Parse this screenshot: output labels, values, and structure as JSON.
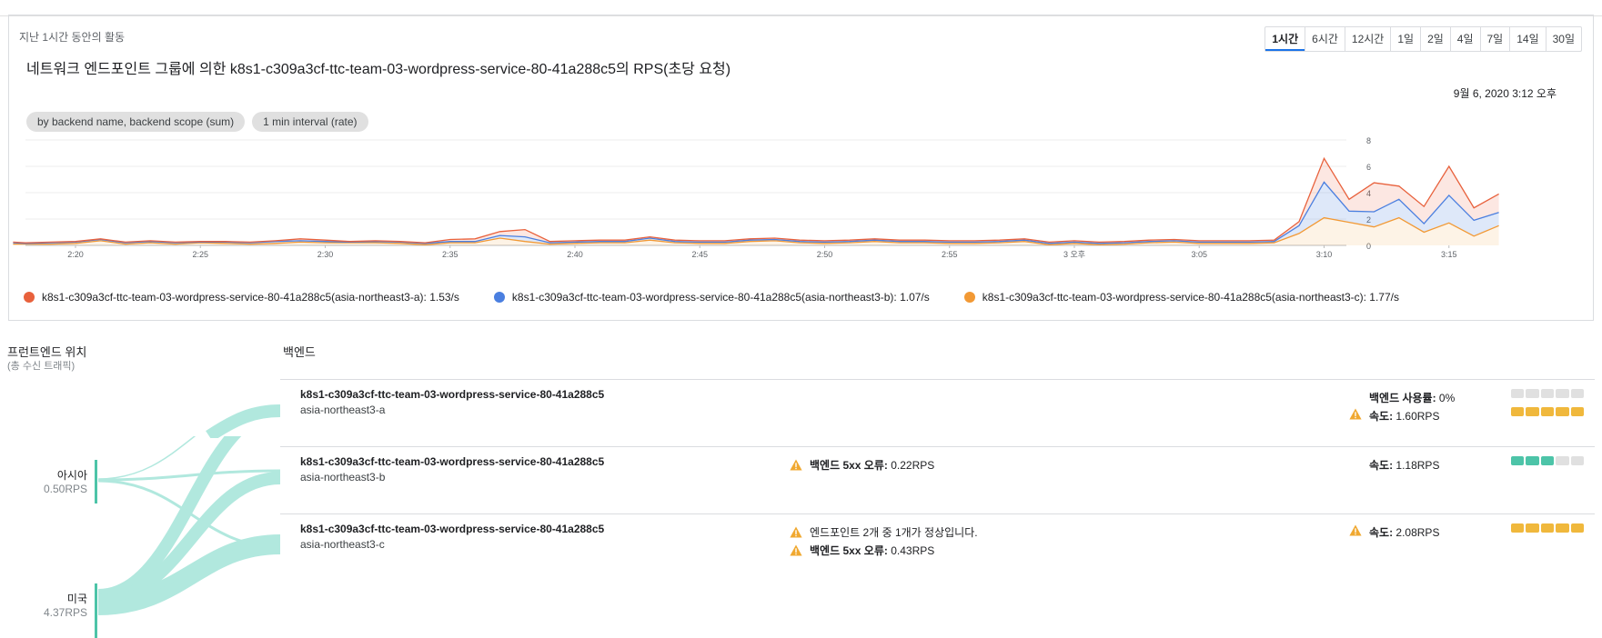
{
  "card": {
    "caption": "지난 1시간 동안의 활동",
    "title": "네트워크 엔드포인트 그룹에 의한 k8s1-c309a3cf-ttc-team-03-wordpress-service-80-41a288c5의 RPS(초당 요청)",
    "date": "9월 6, 2020 3:12 오후",
    "chips": [
      "by backend name, backend scope (sum)",
      "1 min interval (rate)"
    ],
    "range_tabs": [
      "1시간",
      "6시간",
      "12시간",
      "1일",
      "2일",
      "4일",
      "7일",
      "14일",
      "30일"
    ],
    "active_range": "1시간"
  },
  "chart_data": {
    "type": "line",
    "stacked": true,
    "x_tick_labels": [
      "2:20",
      "2:25",
      "2:30",
      "2:35",
      "2:40",
      "2:45",
      "2:50",
      "2:55",
      "3 오후",
      "3:05",
      "3:10",
      "3:15"
    ],
    "y_ticks": [
      0,
      2,
      4,
      6,
      8
    ],
    "ylim": [
      0,
      8
    ],
    "x_minutes": [
      17.5,
      18,
      19,
      20,
      21,
      22,
      23,
      24,
      25,
      26,
      27,
      28,
      29,
      30,
      31,
      32,
      33,
      34,
      35,
      36,
      37,
      38,
      39,
      40,
      41,
      42,
      43,
      44,
      45,
      46,
      47,
      48,
      49,
      50,
      51,
      52,
      53,
      54,
      55,
      56,
      57,
      58,
      59,
      60,
      61,
      62,
      63,
      64,
      65,
      66,
      67,
      68,
      69,
      70,
      71,
      72,
      73,
      74,
      75,
      76,
      77
    ],
    "series": [
      {
        "name": "k8s1-c309a3cf-ttc-team-03-wordpress-service-80-41a288c5(asia-northeast3-c)",
        "color": "#f29934",
        "values": [
          0.1,
          0.1,
          0.1,
          0.15,
          0.35,
          0.1,
          0.2,
          0.1,
          0.2,
          0.15,
          0.1,
          0.15,
          0.25,
          0.2,
          0.2,
          0.2,
          0.15,
          0.05,
          0.2,
          0.2,
          0.55,
          0.3,
          0.1,
          0.15,
          0.2,
          0.2,
          0.4,
          0.2,
          0.15,
          0.15,
          0.3,
          0.35,
          0.2,
          0.15,
          0.2,
          0.3,
          0.2,
          0.2,
          0.15,
          0.15,
          0.2,
          0.3,
          0.05,
          0.15,
          0.05,
          0.1,
          0.2,
          0.25,
          0.15,
          0.15,
          0.15,
          0.2,
          0.9,
          2.1,
          1.75,
          1.4,
          2.1,
          1.0,
          1.7,
          0.7,
          1.5,
          0.95,
          1.77
        ]
      },
      {
        "name": "k8s1-c309a3cf-ttc-team-03-wordpress-service-80-41a288c5(asia-northeast3-b)",
        "color": "#4a7fe0",
        "values": [
          0.1,
          0.05,
          0.1,
          0.1,
          0.1,
          0.1,
          0.1,
          0.1,
          0.05,
          0.1,
          0.1,
          0.15,
          0.1,
          0.1,
          0.05,
          0.1,
          0.1,
          0.1,
          0.1,
          0.1,
          0.2,
          0.35,
          0.1,
          0.1,
          0.1,
          0.1,
          0.15,
          0.1,
          0.1,
          0.1,
          0.1,
          0.1,
          0.1,
          0.1,
          0.1,
          0.1,
          0.1,
          0.1,
          0.1,
          0.1,
          0.1,
          0.1,
          0.1,
          0.1,
          0.1,
          0.1,
          0.1,
          0.1,
          0.1,
          0.1,
          0.1,
          0.1,
          0.6,
          2.7,
          0.85,
          1.15,
          1.4,
          0.65,
          2.1,
          1.2,
          1.0,
          1.0,
          1.07
        ]
      },
      {
        "name": "k8s1-c309a3cf-ttc-team-03-wordpress-service-80-41a288c5(asia-northeast3-a)",
        "color": "#e8613c",
        "values": [
          0.05,
          0.05,
          0.05,
          0.05,
          0.05,
          0.05,
          0.05,
          0.05,
          0.05,
          0.05,
          0.05,
          0.05,
          0.15,
          0.1,
          0.05,
          0.05,
          0.05,
          0.05,
          0.15,
          0.2,
          0.3,
          0.55,
          0.1,
          0.1,
          0.1,
          0.1,
          0.1,
          0.1,
          0.1,
          0.1,
          0.1,
          0.1,
          0.1,
          0.1,
          0.1,
          0.1,
          0.1,
          0.1,
          0.1,
          0.1,
          0.1,
          0.1,
          0.1,
          0.1,
          0.1,
          0.1,
          0.1,
          0.1,
          0.1,
          0.1,
          0.1,
          0.1,
          0.3,
          1.8,
          0.9,
          2.2,
          1.0,
          1.3,
          2.2,
          0.95,
          1.4,
          0.75,
          1.53
        ]
      }
    ],
    "legend": [
      {
        "name": "k8s1-c309a3cf-ttc-team-03-wordpress-service-80-41a288c5(asia-northeast3-a): 1.53/s",
        "color": "#e8613c"
      },
      {
        "name": "k8s1-c309a3cf-ttc-team-03-wordpress-service-80-41a288c5(asia-northeast3-b): 1.07/s",
        "color": "#4a7fe0"
      },
      {
        "name": "k8s1-c309a3cf-ttc-team-03-wordpress-service-80-41a288c5(asia-northeast3-c): 1.77/s",
        "color": "#f29934"
      }
    ]
  },
  "frontend": {
    "title": "프런트엔드 위치",
    "subtitle": "(총 수신 트래픽)",
    "regions": [
      {
        "name": "아시아",
        "rps": "0.50RPS"
      },
      {
        "name": "미국",
        "rps": "4.37RPS"
      }
    ]
  },
  "backend": {
    "title": "백엔드",
    "rows": [
      {
        "name": "k8s1-c309a3cf-ttc-team-03-wordpress-service-80-41a288c5",
        "zone": "asia-northeast3-a",
        "messages": [],
        "stats": [
          {
            "warn": false,
            "label": "백엔드 사용률:",
            "value": " 0%",
            "bar_fill": 0.0,
            "bar_color": "#e0e0e0"
          },
          {
            "warn": true,
            "label": "속도:",
            "value": " 1.60RPS",
            "bar_fill": 1.0,
            "bar_color": "#f0b83c"
          }
        ]
      },
      {
        "name": "k8s1-c309a3cf-ttc-team-03-wordpress-service-80-41a288c5",
        "zone": "asia-northeast3-b",
        "messages": [
          {
            "bold": "백엔드 5xx 오류:",
            "text": " 0.22RPS"
          }
        ],
        "stats": [
          {
            "warn": false,
            "label": "속도:",
            "value": " 1.18RPS",
            "bar_fill": 0.6,
            "bar_color": "#4dc4a8"
          }
        ]
      },
      {
        "name": "k8s1-c309a3cf-ttc-team-03-wordpress-service-80-41a288c5",
        "zone": "asia-northeast3-c",
        "messages": [
          {
            "bold": "",
            "text": "엔드포인트 2개 중 1개가 정상입니다."
          },
          {
            "bold": "백엔드 5xx 오류:",
            "text": " 0.43RPS"
          }
        ],
        "stats": [
          {
            "warn": true,
            "label": "속도:",
            "value": " 2.08RPS",
            "bar_fill": 1.0,
            "bar_color": "#f0b83c"
          }
        ]
      }
    ]
  }
}
